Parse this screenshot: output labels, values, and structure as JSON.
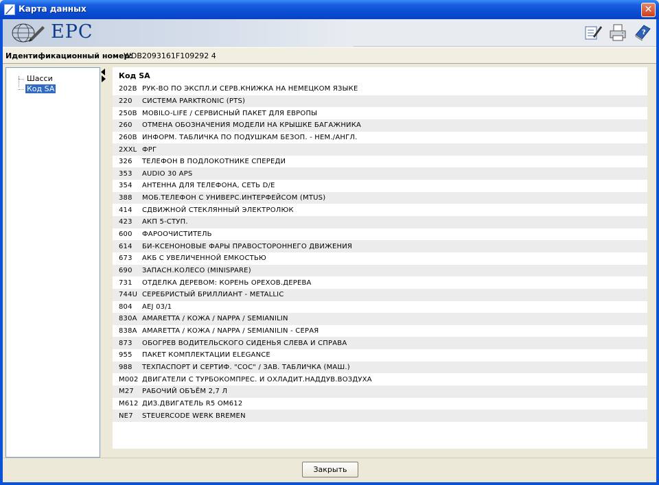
{
  "window": {
    "title": "Карта данных",
    "close_glyph": "✕"
  },
  "banner": {
    "logo_text": "EPC",
    "tools": [
      "edit-list-icon",
      "print-icon",
      "help-book-icon"
    ]
  },
  "idbar": {
    "label": "Идентификационный номер:",
    "value": "WDB2093161F109292 4"
  },
  "tree": {
    "items": [
      {
        "label": "Шасси"
      },
      {
        "label": "Код SA"
      }
    ]
  },
  "table": {
    "header": "Код SA",
    "rows": [
      {
        "code": "202B",
        "desc": "РУК-ВО ПО ЭКСПЛ.И СЕРВ.КНИЖКА НА НЕМЕЦКОМ ЯЗЫКЕ"
      },
      {
        "code": "220",
        "desc": "СИСТЕМА PARKTRONIC (PTS)"
      },
      {
        "code": "250B",
        "desc": "MOBILO-LIFE / СЕРВИСНЫЙ ПАКЕТ ДЛЯ ЕВРОПЫ"
      },
      {
        "code": "260",
        "desc": "ОТМЕНА ОБОЗНАЧЕНИЯ МОДЕЛИ НА КРЫШКЕ БАГАЖНИКА"
      },
      {
        "code": "260B",
        "desc": "ИНФОРМ. ТАБЛИЧКА ПО ПОДУШКАМ БЕЗОП. - НЕМ./АНГЛ."
      },
      {
        "code": "2XXL",
        "desc": "ФРГ"
      },
      {
        "code": "326",
        "desc": "ТЕЛЕФОН В ПОДЛОКОТНИКЕ СПЕРЕДИ"
      },
      {
        "code": "353",
        "desc": "AUDIO 30 APS"
      },
      {
        "code": "354",
        "desc": "АНТЕННА ДЛЯ ТЕЛЕФОНА, СЕТЬ D/E"
      },
      {
        "code": "388",
        "desc": "МОБ.ТЕЛЕФОН С УНИВЕРС.ИНТЕРФЕЙСОМ (MTUS)"
      },
      {
        "code": "414",
        "desc": "СДВИЖНОЙ СТЕКЛЯННЫЙ ЭЛЕКТРОЛЮК"
      },
      {
        "code": "423",
        "desc": "АКП 5-СТУП."
      },
      {
        "code": "600",
        "desc": "ФАРООЧИСТИТЕЛЬ"
      },
      {
        "code": "614",
        "desc": "БИ-КСЕНОНОВЫЕ ФАРЫ ПРАВОСТОРОННЕГО ДВИЖЕНИЯ"
      },
      {
        "code": "673",
        "desc": "АКБ С УВЕЛИЧЕННОЙ ЕМКОСТЬЮ"
      },
      {
        "code": "690",
        "desc": "ЗАПАСН.КОЛЕСО (MINISPARE)"
      },
      {
        "code": "731",
        "desc": "ОТДЕЛКА ДЕРЕВОМ: КОРЕНЬ ОРЕХОВ.ДЕРЕВА"
      },
      {
        "code": "744U",
        "desc": "СЕРЕБРИСТЫЙ БРИЛЛИАНТ - METALLIC"
      },
      {
        "code": "804",
        "desc": "AEJ 03/1"
      },
      {
        "code": "830A",
        "desc": "AMARETTA / КОЖА / NAPPA / SEMIANILIN"
      },
      {
        "code": "838A",
        "desc": "AMARETTA / КОЖА / NAPPA / SEMIANILIN - СЕРАЯ"
      },
      {
        "code": "873",
        "desc": "ОБОГРЕВ ВОДИТЕЛЬСКОГО СИДЕНЬЯ СЛЕВА И СПРАВА"
      },
      {
        "code": "955",
        "desc": "ПАКЕТ КОМПЛЕКТАЦИИ ELEGANCE"
      },
      {
        "code": "988",
        "desc": "ТЕХПАСПОРТ И СЕРТИФ. \"СОС\" / ЗАВ. ТАБЛИЧКА (МАШ.)"
      },
      {
        "code": "M002",
        "desc": "ДВИГАТЕЛИ С ТУРБОКОМПРЕС. И ОХЛАДИТ.НАДДУВ.ВОЗДУХА"
      },
      {
        "code": "M27",
        "desc": "РАБОЧИЙ ОБЪЁМ 2,7 Л"
      },
      {
        "code": "M612",
        "desc": "ДИЗ.ДВИГАТЕЛЬ R5 OM612"
      },
      {
        "code": "NE7",
        "desc": "STEUERCODE WERK BREMEN"
      }
    ]
  },
  "footer": {
    "close_label": "Закрыть"
  }
}
